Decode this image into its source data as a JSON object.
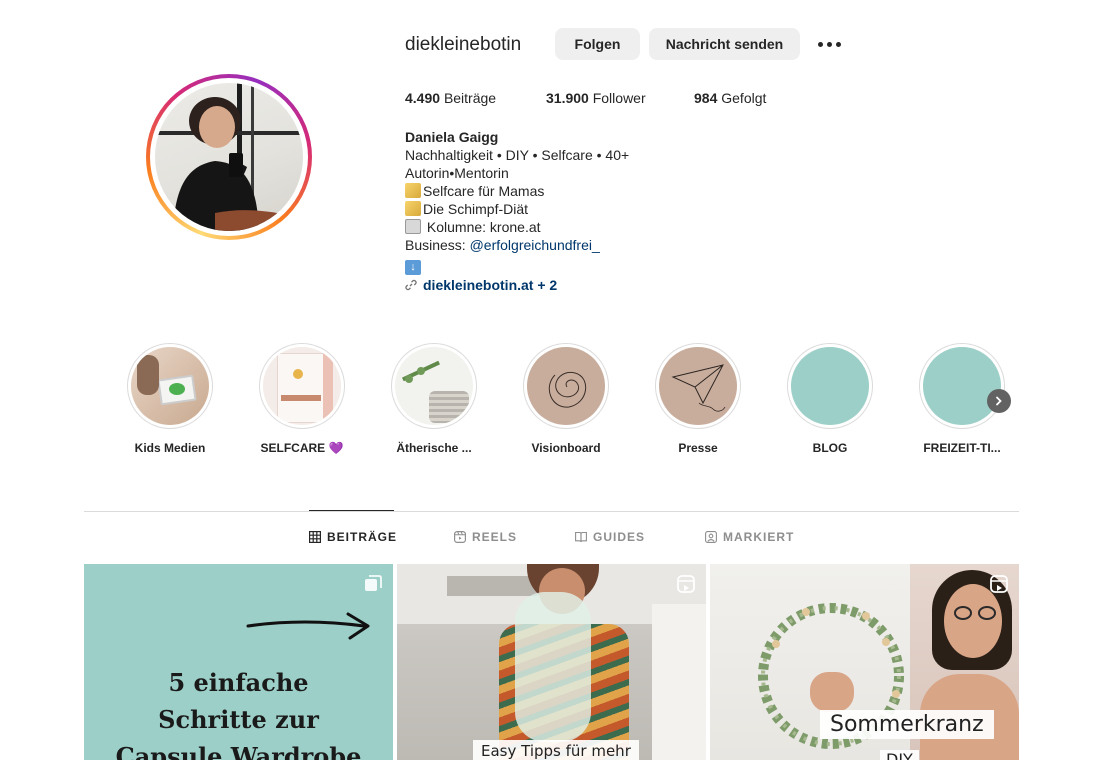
{
  "profile": {
    "username": "diekleinebotin",
    "follow_label": "Folgen",
    "message_label": "Nachricht senden",
    "more_icon": "more-horizontal-icon"
  },
  "stats": {
    "posts_count": "4.490",
    "posts_label": "Beiträge",
    "followers_count": "31.900",
    "followers_label": "Follower",
    "following_count": "984",
    "following_label": "Gefolgt"
  },
  "bio": {
    "name": "Daniela Gaigg",
    "line1": "Nachhaltigkeit • DIY • Selfcare • 40+",
    "line2": "Autorin•Mentorin",
    "line3": "Selfcare für Mamas",
    "line4": "Die Schimpf-Diät",
    "line5": "Kolumne: krone.at",
    "business_label": "Business:",
    "business_mention": "@erfolgreichundfrei_",
    "link_text": "diekleinebotin.at + 2"
  },
  "highlights": [
    {
      "label": "Kids Medien"
    },
    {
      "label": "SELFCARE 💜"
    },
    {
      "label": "Ätherische ..."
    },
    {
      "label": "Visionboard"
    },
    {
      "label": "Presse"
    },
    {
      "label": "BLOG"
    },
    {
      "label": "FREIZEIT-TI..."
    }
  ],
  "tabs": [
    {
      "label": "BEITRÄGE",
      "icon": "grid-icon",
      "active": true
    },
    {
      "label": "REELS",
      "icon": "reels-icon",
      "active": false
    },
    {
      "label": "GUIDES",
      "icon": "guides-icon",
      "active": false
    },
    {
      "label": "MARKIERT",
      "icon": "tagged-icon",
      "active": false
    }
  ],
  "posts": [
    {
      "type": "carousel",
      "text_lines": [
        "5 einfache",
        "Schritte zur",
        "Capsule Wardrobe"
      ]
    },
    {
      "type": "reel",
      "caption": "Easy Tipps für mehr"
    },
    {
      "type": "reel",
      "caption": "Sommerkranz",
      "caption2": "DIY"
    }
  ],
  "colors": {
    "story_ring": "#d62976",
    "link": "#00376b",
    "button_bg": "#efefef",
    "post_teal": "#9ccfc8"
  }
}
